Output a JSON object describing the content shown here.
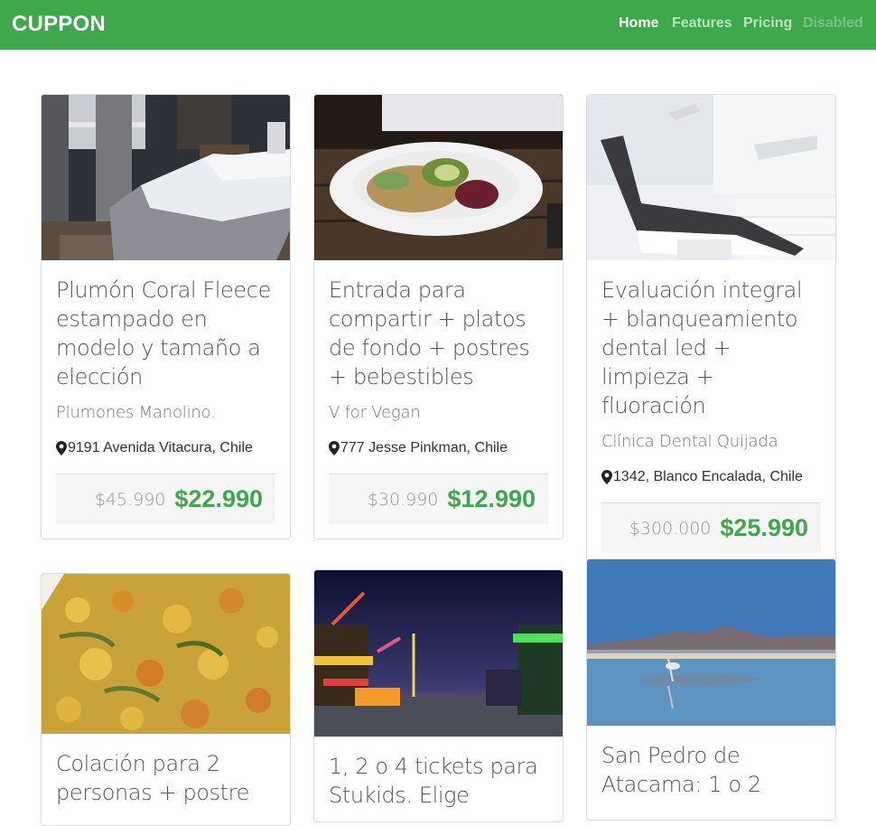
{
  "nav": {
    "brand": "CUPPON",
    "links": [
      {
        "label": "Home"
      },
      {
        "label": "Features"
      },
      {
        "label": "Pricing"
      },
      {
        "label": "Disabled"
      }
    ]
  },
  "deals": [
    {
      "title": "Plumón Coral Fleece estampado en modelo y tamaño a elección",
      "merchant": "Plumones Manolino.",
      "location": "9191 Avenida Vitacura, Chile",
      "price_old": "$45.990",
      "price_new": "$22.990",
      "image": "bedroom"
    },
    {
      "title": "Entrada para compartir + platos de fondo + postres + bebestibles",
      "merchant": "V for Vegan",
      "location": "777 Jesse Pinkman, Chile",
      "price_old": "$30.990",
      "price_new": "$12.990",
      "image": "vegan-plate"
    },
    {
      "title": "Evaluación integral + blanqueamiento dental led + limpieza + fluoración",
      "merchant": "Clínica Dental Quijada",
      "location": "1342, Blanco Encalada, Chile",
      "price_old": "$300.000",
      "price_new": "$25.990",
      "image": "dental-chair"
    },
    {
      "title": "Colación para 2 personas + postre",
      "image": "food-dish"
    },
    {
      "title": "1, 2 o 4 tickets para Stukids. Elige",
      "image": "fair-night"
    },
    {
      "title": "San Pedro de Atacama: 1 o 2",
      "image": "salt-lake"
    }
  ],
  "colors": {
    "brand_green": "#3ea84b",
    "price_box": "#f5f5f5"
  },
  "icons": {
    "location": "map-marker-icon"
  }
}
